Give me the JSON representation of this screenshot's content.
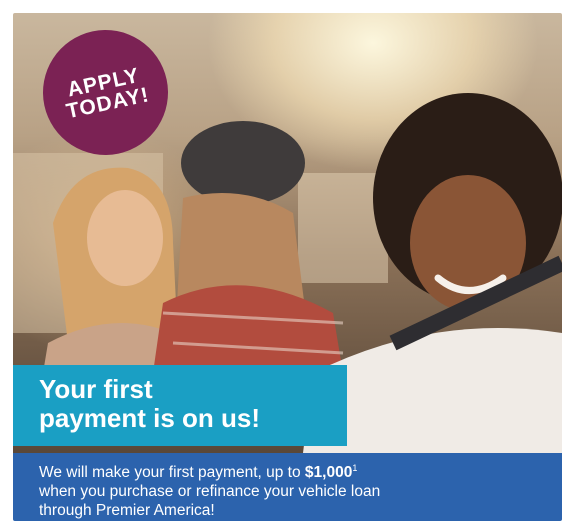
{
  "badge": {
    "line1": "APPLY",
    "line2": "TODAY!"
  },
  "headline": {
    "line1": "Your first",
    "line2": "payment is on us!"
  },
  "blurb": {
    "part1": "We will make your first payment, up to ",
    "amount": "$1,000",
    "footnote": "1",
    "line2": "when you purchase or refinance your vehicle loan",
    "line3": "through Premier America!"
  }
}
